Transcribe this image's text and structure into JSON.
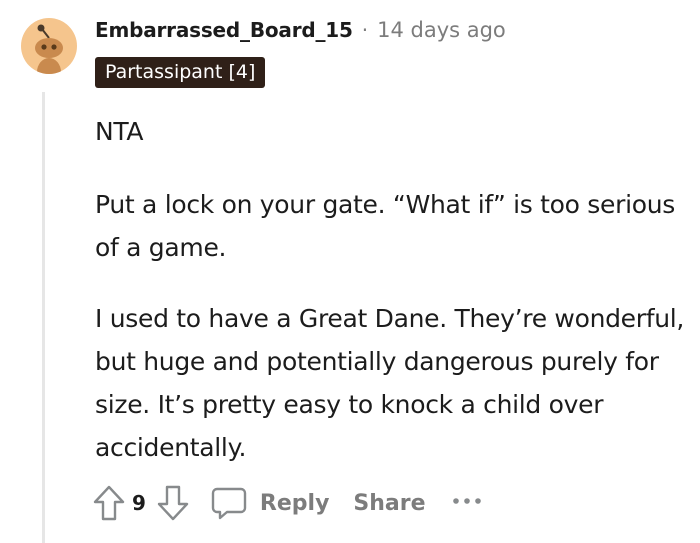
{
  "comment": {
    "username": "Embarrassed_Board_15",
    "separator": "·",
    "timestamp": "14 days ago",
    "flair": "Partassipant [4]",
    "paragraphs": [
      "NTA",
      "Put a lock on your gate. “What if” is too serious of a game.",
      "I used to have a Great Dane. They’re wonderful, but huge and potentially dangerous purely for size. It’s pretty easy to knock a child over accidentally."
    ]
  },
  "actions": {
    "vote_count": "9",
    "reply_label": "Reply",
    "share_label": "Share"
  },
  "colors": {
    "avatar_bg": "#f5c58d",
    "flair_bg": "#2f2018",
    "muted": "#7c7c7c",
    "text": "#1c1c1c"
  }
}
